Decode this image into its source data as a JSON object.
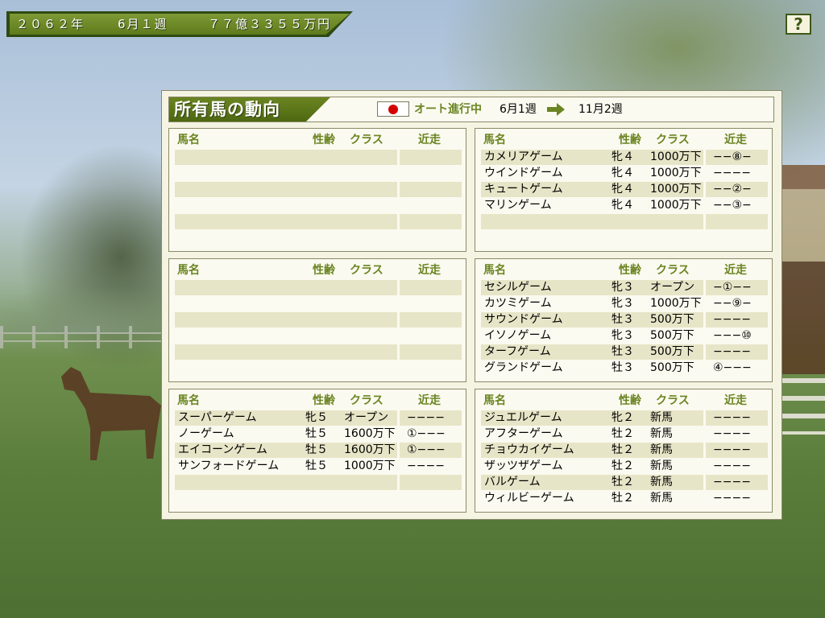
{
  "status": {
    "year": "２０６２年",
    "week": "6月１週",
    "money": "７７億３３５５万円",
    "help_label": "?"
  },
  "header": {
    "title": "所有馬の動向",
    "auto_label": "オート進行中",
    "from_week": "6月1週",
    "to_week": "11月2週"
  },
  "columns": {
    "name": "馬名",
    "sexage": "性齢",
    "class": "クラス",
    "recent": "近走"
  },
  "stables": [
    {
      "horses": []
    },
    {
      "horses": [
        {
          "name": "カメリアゲーム",
          "sexage": "牝４",
          "class": "1000万下",
          "recent": "−−⑧−"
        },
        {
          "name": "ウインドゲーム",
          "sexage": "牝４",
          "class": "1000万下",
          "recent": "−−−−"
        },
        {
          "name": "キュートゲーム",
          "sexage": "牝４",
          "class": "1000万下",
          "recent": "−−②−"
        },
        {
          "name": "マリンゲーム",
          "sexage": "牝４",
          "class": "1000万下",
          "recent": "−−③−"
        }
      ]
    },
    {
      "horses": []
    },
    {
      "horses": [
        {
          "name": "セシルゲーム",
          "sexage": "牝３",
          "class": "オープン",
          "recent": "−①−−"
        },
        {
          "name": "カツミゲーム",
          "sexage": "牝３",
          "class": "1000万下",
          "recent": "−−⑨−"
        },
        {
          "name": "サウンドゲーム",
          "sexage": "牡３",
          "class": "500万下",
          "recent": "−−−−"
        },
        {
          "name": "イソノゲーム",
          "sexage": "牝３",
          "class": "500万下",
          "recent": "−−−⑩"
        },
        {
          "name": "ターフゲーム",
          "sexage": "牡３",
          "class": "500万下",
          "recent": "−−−−"
        },
        {
          "name": "グランドゲーム",
          "sexage": "牡３",
          "class": "500万下",
          "recent": "④−−−"
        }
      ]
    },
    {
      "horses": [
        {
          "name": "スーパーゲーム",
          "sexage": "牝５",
          "class": "オープン",
          "recent": "−−−−"
        },
        {
          "name": "ノーゲーム",
          "sexage": "牡５",
          "class": "1600万下",
          "recent": "①−−−"
        },
        {
          "name": "エイコーンゲーム",
          "sexage": "牡５",
          "class": "1600万下",
          "recent": "①−−−"
        },
        {
          "name": "サンフォードゲーム",
          "sexage": "牡５",
          "class": "1000万下",
          "recent": "−−−−"
        }
      ]
    },
    {
      "horses": [
        {
          "name": "ジュエルゲーム",
          "sexage": "牝２",
          "class": "新馬",
          "recent": "−−−−"
        },
        {
          "name": "アフターゲーム",
          "sexage": "牡２",
          "class": "新馬",
          "recent": "−−−−"
        },
        {
          "name": "チョウカイゲーム",
          "sexage": "牡２",
          "class": "新馬",
          "recent": "−−−−"
        },
        {
          "name": "ザッツザゲーム",
          "sexage": "牡２",
          "class": "新馬",
          "recent": "−−−−"
        },
        {
          "name": "バルゲーム",
          "sexage": "牡２",
          "class": "新馬",
          "recent": "−−−−"
        },
        {
          "name": "ウィルビーゲーム",
          "sexage": "牡２",
          "class": "新馬",
          "recent": "−−−−"
        }
      ]
    }
  ],
  "icons": {
    "help": "help-icon",
    "flag": "japan-flag-icon",
    "arrow": "arrow-right-icon"
  },
  "colors": {
    "accent": "#6a8421",
    "panel": "#f5f3e2",
    "row_shade": "#e7e5c7",
    "flag_red": "#d40000"
  }
}
